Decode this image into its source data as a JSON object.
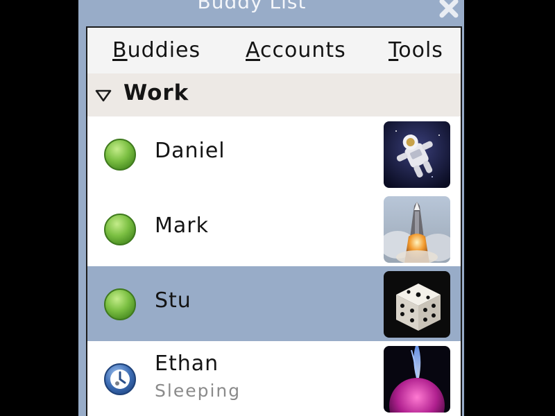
{
  "window": {
    "title": "Buddy List"
  },
  "menu": [
    {
      "mnemonic": "B",
      "rest": "uddies"
    },
    {
      "mnemonic": "A",
      "rest": "ccounts"
    },
    {
      "mnemonic": "T",
      "rest": "ools"
    }
  ],
  "group": {
    "label": "Work",
    "expanded": true
  },
  "buddies": [
    {
      "name": "Daniel",
      "status": "",
      "presence": "available",
      "avatar": "astronaut-avatar",
      "selected": false
    },
    {
      "name": "Mark",
      "status": "",
      "presence": "available",
      "avatar": "shuttle-launch-avatar",
      "selected": false
    },
    {
      "name": "Stu",
      "status": "",
      "presence": "available",
      "avatar": "dice-avatar",
      "selected": true
    },
    {
      "name": "Ethan",
      "status": "Sleeping",
      "presence": "away",
      "avatar": "plasma-avatar",
      "selected": false
    }
  ],
  "colors": {
    "frame": "#98acc8",
    "selection": "#98acc8",
    "available": "#7cc043",
    "away": "#3f6fb6",
    "status_text": "#8a8a8a"
  }
}
